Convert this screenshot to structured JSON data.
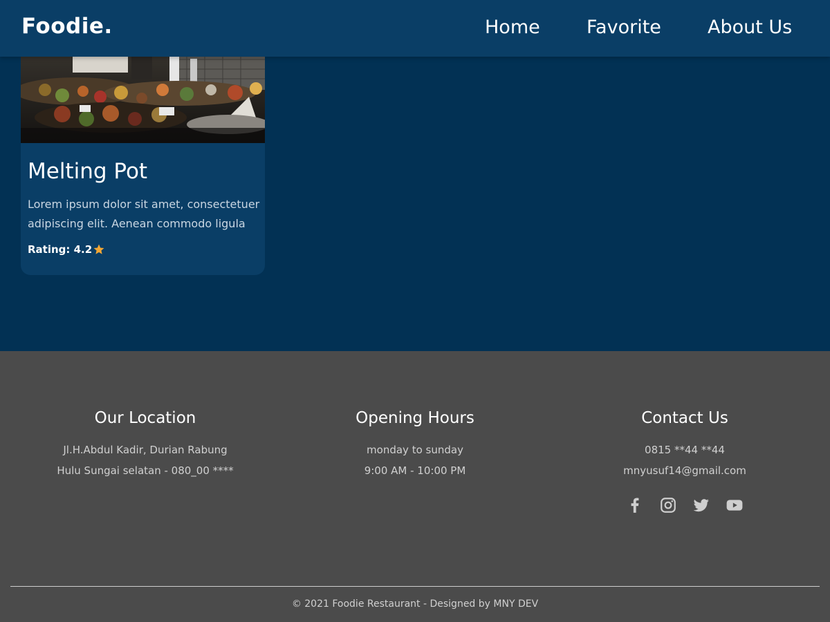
{
  "nav": {
    "brand": "Foodie.",
    "links": [
      {
        "label": "Home"
      },
      {
        "label": "Favorite"
      },
      {
        "label": "About Us"
      }
    ]
  },
  "restaurant": {
    "name": "Melting Pot",
    "description": "Lorem ipsum dolor sit amet, consectetuer adipiscing elit. Aenean commodo ligula",
    "rating_label": "Rating: 4.2",
    "rating_icon": "star-icon",
    "star_color": "#f2a735"
  },
  "footer": {
    "location": {
      "title": "Our Location",
      "line1": "Jl.H.Abdul Kadir, Durian Rabung",
      "line2": "Hulu Sungai selatan - 080_00 ****"
    },
    "hours": {
      "title": "Opening Hours",
      "line1": "monday to sunday",
      "line2": "9:00 AM - 10:00 PM"
    },
    "contact": {
      "title": "Contact Us",
      "phone": "0815 **44 **44",
      "email": "mnyusuf14@gmail.com",
      "social_icons": [
        "facebook-icon",
        "instagram-icon",
        "twitter-icon",
        "youtube-icon"
      ]
    },
    "copyright": "© 2021 Foodie Restaurant - Designed by MNY DEV"
  },
  "colors": {
    "navbar": "#0a3e66",
    "page_background": "#023154",
    "card": "#0a3e66",
    "footer": "#4b4b4b"
  }
}
